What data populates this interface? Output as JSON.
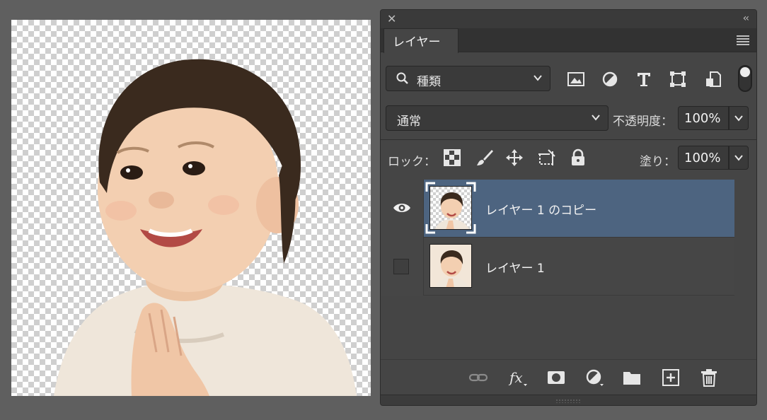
{
  "canvas": {
    "document": "child-photo-transparent-background"
  },
  "panel": {
    "tab_label": "レイヤー",
    "filter": {
      "kind_label": "種類",
      "icons": [
        "image-filter-icon",
        "adjustment-filter-icon",
        "type-filter-icon",
        "shape-filter-icon",
        "smart-object-filter-icon"
      ]
    },
    "blend_mode": "通常",
    "opacity_label": "不透明度：",
    "opacity_value": "100%",
    "lock_label": "ロック：",
    "lock_icons": [
      "lock-transparent-pixels-icon",
      "lock-image-pixels-icon",
      "lock-position-icon",
      "prevent-auto-nesting-icon",
      "lock-all-icon"
    ],
    "fill_label": "塗り：",
    "fill_value": "100%",
    "layers": [
      {
        "name": "レイヤー 1 のコピー",
        "visible": true,
        "selected": true,
        "thumbnail": "transparent"
      },
      {
        "name": "レイヤー 1",
        "visible": false,
        "selected": false,
        "thumbnail": "solid"
      }
    ],
    "bottom_icons": [
      "link-layers-icon",
      "fx-icon",
      "layer-mask-icon",
      "adjustment-layer-icon",
      "group-folder-icon",
      "new-layer-icon",
      "trash-icon"
    ],
    "colors": {
      "selected_row": "#4d6480",
      "panel_bg": "#454545"
    }
  }
}
